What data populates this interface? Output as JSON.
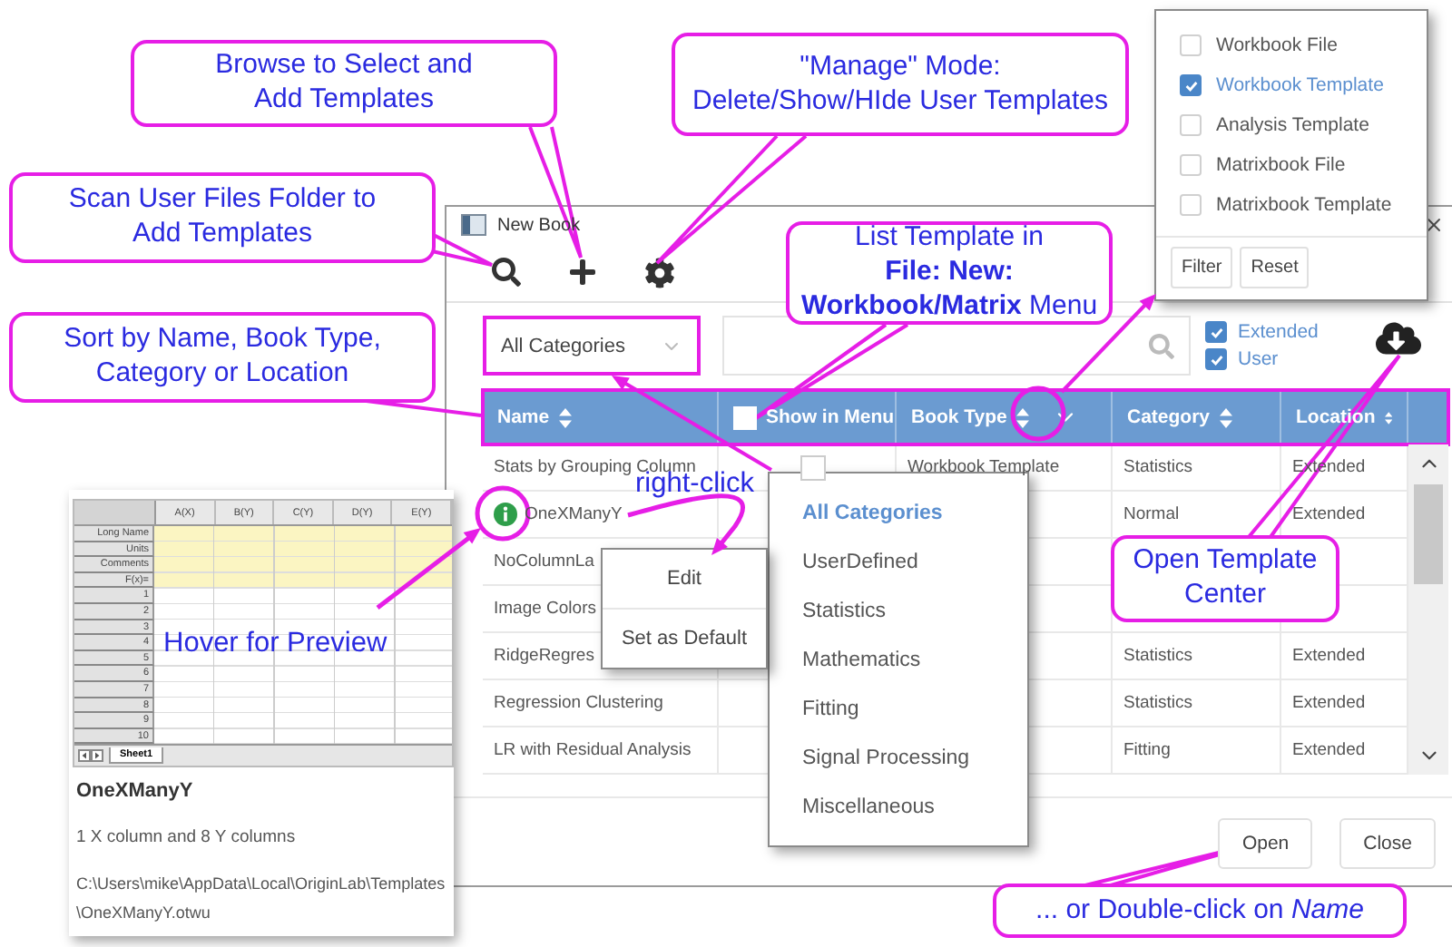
{
  "window": {
    "title": "New Book"
  },
  "category_select": {
    "value": "All Categories"
  },
  "source_filters": [
    {
      "label": "Extended",
      "checked": true
    },
    {
      "label": "User",
      "checked": true
    }
  ],
  "table": {
    "columns": [
      {
        "label": "Name",
        "kind": "sort",
        "filter": false
      },
      {
        "label": "Show in Menu",
        "kind": "checkbox",
        "filter": false,
        "checked": false
      },
      {
        "label": "Book Type",
        "kind": "sort",
        "filter": true
      },
      {
        "label": "Category",
        "kind": "sort",
        "filter": false
      },
      {
        "label": "Location",
        "kind": "sort",
        "filter": false
      }
    ],
    "rows": [
      {
        "name": "Stats by Grouping Column",
        "hovered": false,
        "show_in_menu": false,
        "book_type": "Workbook Template",
        "category": "Statistics",
        "location": "Extended"
      },
      {
        "name": "OneXManyY",
        "hovered": true,
        "category": "Normal",
        "location": "Extended"
      },
      {
        "name": "NoColumnLa",
        "hovered": false
      },
      {
        "name": "Image Colors",
        "hovered": false
      },
      {
        "name": "RidgeRegres",
        "hovered": false,
        "category": "Statistics",
        "location": "Extended"
      },
      {
        "name": "Regression Clustering",
        "hovered": false,
        "category": "Statistics",
        "location": "Extended"
      },
      {
        "name": "LR with Residual Analysis",
        "hovered": false,
        "category": "Fitting",
        "location": "Extended"
      }
    ]
  },
  "buttons": [
    "Open",
    "Close"
  ],
  "category_menu": {
    "items": [
      {
        "label": "All Categories",
        "selected": true
      },
      {
        "label": "UserDefined",
        "selected": false
      },
      {
        "label": "Statistics",
        "selected": false
      },
      {
        "label": "Mathematics",
        "selected": false
      },
      {
        "label": "Fitting",
        "selected": false
      },
      {
        "label": "Signal Processing",
        "selected": false
      },
      {
        "label": "Miscellaneous",
        "selected": false
      }
    ]
  },
  "context_menu": {
    "items": [
      "Edit",
      "Set as Default"
    ]
  },
  "book_type_filter": {
    "items": [
      {
        "label": "Workbook File",
        "checked": false
      },
      {
        "label": "Workbook Template",
        "checked": true
      },
      {
        "label": "Analysis Template",
        "checked": false
      },
      {
        "label": "Matrixbook File",
        "checked": false
      },
      {
        "label": "Matrixbook Template",
        "checked": false
      }
    ],
    "buttons": [
      "Filter",
      "Reset"
    ]
  },
  "preview": {
    "worksheet": {
      "columns": [
        "A(X)",
        "B(Y)",
        "C(Y)",
        "D(Y)",
        "E(Y)"
      ],
      "row_labels": [
        "Long Name",
        "Units",
        "Comments",
        "F(x)=",
        "1",
        "2",
        "3",
        "4",
        "5",
        "6",
        "7",
        "8",
        "9",
        "10"
      ],
      "sheet_tab": "Sheet1"
    },
    "title": "OneXManyY",
    "description": "1 X column and 8 Y columns",
    "path": [
      "C:\\Users\\mike\\AppData\\Local\\OriginLab\\Templates",
      "\\OneXManyY.otwu"
    ]
  },
  "annotations": {
    "callouts": [
      "Scan User Files Folder to\nAdd Templates",
      "Browse to Select and\nAdd Templates",
      "\"Manage\" Mode:\nDelete/Show/HIde User Templates",
      "Sort by Name, Book Type,\nCategory or Location",
      "List Template in\n**File: New:**\n**Workbook/Matrix** Menu",
      "Open Template\nCenter",
      "... or Double-click on *Name*"
    ],
    "labels": [
      "right-click",
      "Hover for Preview"
    ]
  }
}
